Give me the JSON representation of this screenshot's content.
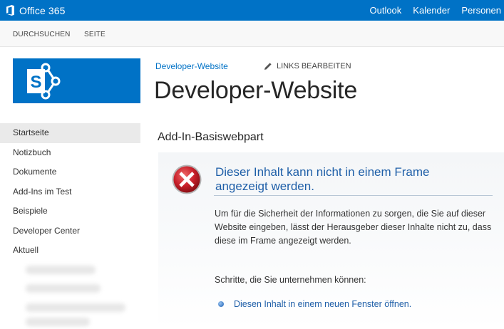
{
  "suitebar": {
    "brand": "Office 365",
    "links": [
      "Outlook",
      "Kalender",
      "Personen"
    ]
  },
  "ribbon": {
    "tabs": [
      "DURCHSUCHEN",
      "SEITE"
    ]
  },
  "header": {
    "breadcrumb": "Developer-Website",
    "edit_links": "LINKS BEARBEITEN",
    "title": "Developer-Website"
  },
  "leftnav": {
    "items": [
      "Startseite",
      "Notizbuch",
      "Dokumente",
      "Add-Ins im Test",
      "Beispiele",
      "Developer Center",
      "Aktuell"
    ]
  },
  "webpart": {
    "title": "Add-In-Basiswebpart",
    "error_title": "Dieser Inhalt kann nicht in einem Frame angezeigt werden.",
    "error_desc": "Um für die Sicherheit der Informationen zu sorgen, die Sie auf dieser Website eingeben, lässt der Herausgeber dieser Inhalte nicht zu, dass diese im Frame angezeigt werden.",
    "steps_label": "Schritte, die Sie unternehmen können:",
    "open_link": "Diesen Inhalt in einem neuen Fenster öffnen."
  },
  "colors": {
    "brand_blue": "#0072c6",
    "error_red": "#c8202a",
    "link_blue": "#1f5fa8"
  }
}
